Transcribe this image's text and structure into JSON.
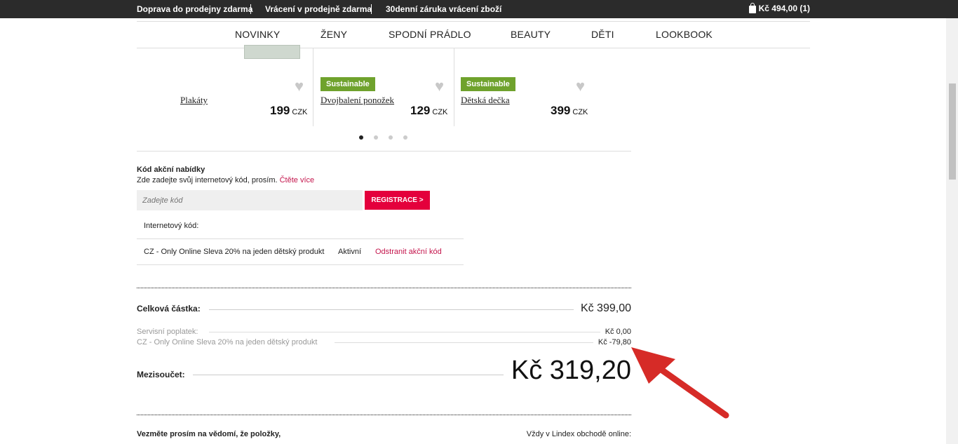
{
  "topbar": {
    "links": [
      "Doprava do prodejny zdarma",
      "Vrácení v prodejně zdarma",
      "30denní záruka vrácení zboží"
    ],
    "cart": "Kč 494,00 (1)"
  },
  "nav": [
    "NOVINKY",
    "ŽENY",
    "SPODNÍ PRÁDLO",
    "BEAUTY",
    "DĚTI",
    "LOOKBOOK"
  ],
  "products": [
    {
      "name": "Plakáty",
      "price": "199",
      "currency": "CZK",
      "badge": ""
    },
    {
      "name": "Dvojbalení ponožek",
      "price": "129",
      "currency": "CZK",
      "badge": "Sustainable"
    },
    {
      "name": "Dětská dečka",
      "price": "399",
      "currency": "CZK",
      "badge": "Sustainable"
    }
  ],
  "promo": {
    "title": "Kód akční nabídky",
    "desc": "Zde zadejte svůj internetový kód, prosím.",
    "read_more": "Čtěte více",
    "placeholder": "Zadejte kód",
    "button": "REGISTRACE >",
    "code_label": "Internetový kód:",
    "code_name": "CZ - Only Online Sleva 20% na jeden dětský produkt",
    "code_status": "Aktivní",
    "code_remove": "Odstranit akční kód"
  },
  "totals": {
    "total_label": "Celková částka:",
    "total_value": "Kč 399,00",
    "fee_label": "Servisní poplatek:",
    "fee_value": "Kč 0,00",
    "discount_label": "CZ - Only Online Sleva 20% na jeden dětský produkt",
    "discount_value": "Kč -79,80",
    "subtotal_label": "Mezisoučet:",
    "subtotal_value": "Kč 319,20"
  },
  "footer": {
    "left": "Vezměte prosím na vědomí, že položky,",
    "right": "Vždy v Lindex obchodě online:"
  },
  "colors": {
    "accent": "#e4003c",
    "badge": "#6fa22d",
    "arrow": "#d62b27"
  }
}
